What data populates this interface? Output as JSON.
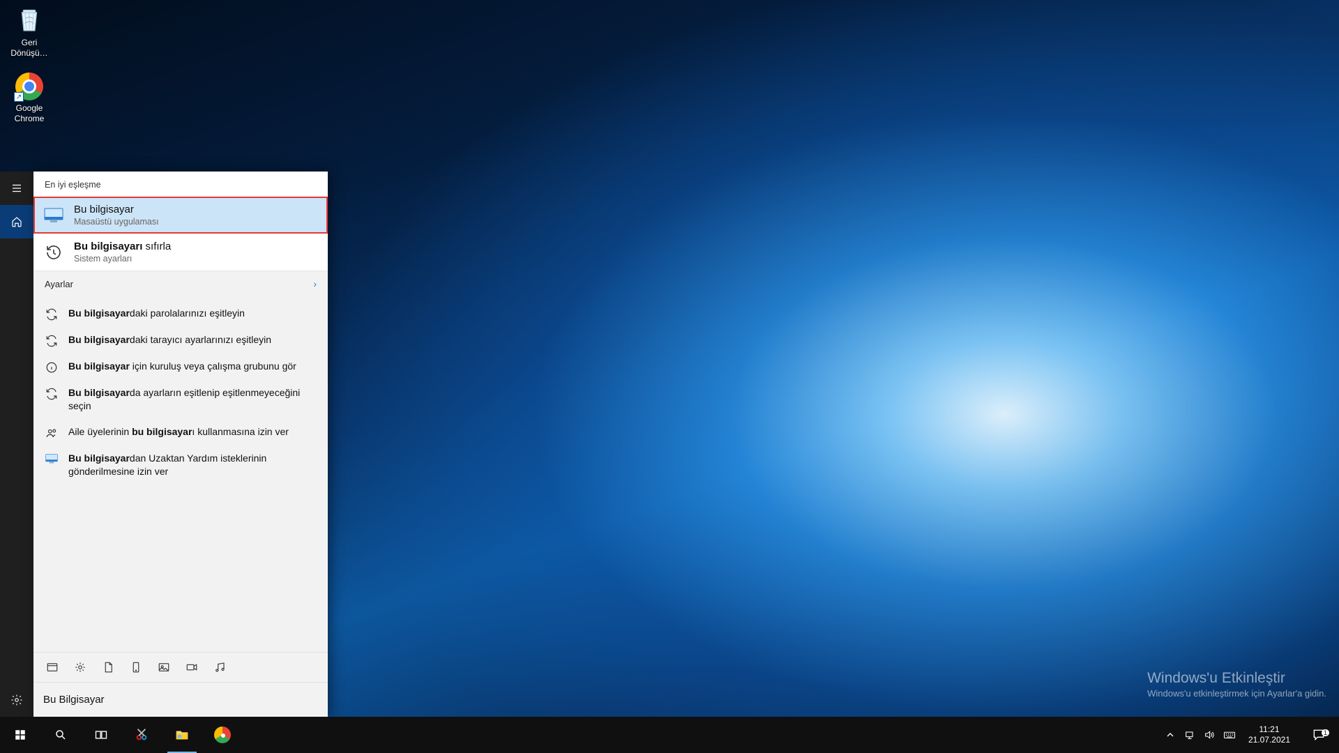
{
  "desktop_icons": [
    {
      "name": "recycle-bin",
      "label": "Geri Dönüşü…"
    },
    {
      "name": "google-chrome",
      "label": "Google Chrome"
    }
  ],
  "search": {
    "header_best_match": "En iyi eşleşme",
    "best_matches": [
      {
        "title": "Bu bilgisayar",
        "subtitle": "Masaüstü uygulaması",
        "icon": "this-pc",
        "selected": true
      },
      {
        "title_prefix": "Bu bilgisayarı ",
        "title_rest": "sıfırla",
        "subtitle": "Sistem ayarları",
        "icon": "history"
      }
    ],
    "settings_label": "Ayarlar",
    "settings_items": [
      {
        "icon": "sync",
        "prefix": "Bu bilgisayar",
        "rest": "daki parolalarınızı eşitleyin"
      },
      {
        "icon": "sync",
        "prefix": "Bu bilgisayar",
        "rest": "daki tarayıcı ayarlarınızı eşitleyin"
      },
      {
        "icon": "info",
        "prefix": "Bu bilgisayar",
        "rest": " için kuruluş veya çalışma grubunu gör"
      },
      {
        "icon": "sync",
        "prefix": "Bu bilgisayar",
        "rest": "da ayarların eşitlenip eşitlenmeyeceğini seçin"
      },
      {
        "icon": "people",
        "before": "Aile üyelerinin ",
        "prefix": "bu bilgisayar",
        "rest": "ı kullanmasına izin ver"
      },
      {
        "icon": "pc",
        "prefix": "Bu bilgisayar",
        "rest": "dan Uzaktan Yardım isteklerinin gönderilmesine izin ver"
      }
    ],
    "filters": [
      "apps",
      "settings",
      "documents",
      "tablet",
      "photos",
      "videos",
      "music"
    ],
    "query": "Bu Bilgisayar"
  },
  "watermark": {
    "title": "Windows'u Etkinleştir",
    "subtitle": "Windows'u etkinleştirmek için Ayarlar'a gidin."
  },
  "taskbar": {
    "buttons": [
      "start",
      "search",
      "task-view",
      "snip",
      "file-explorer",
      "chrome"
    ],
    "active": "file-explorer",
    "tray_icons": [
      "chevron-up",
      "network",
      "volume",
      "keyboard"
    ],
    "time": "11:21",
    "date": "21.07.2021",
    "notification_count": "1"
  }
}
